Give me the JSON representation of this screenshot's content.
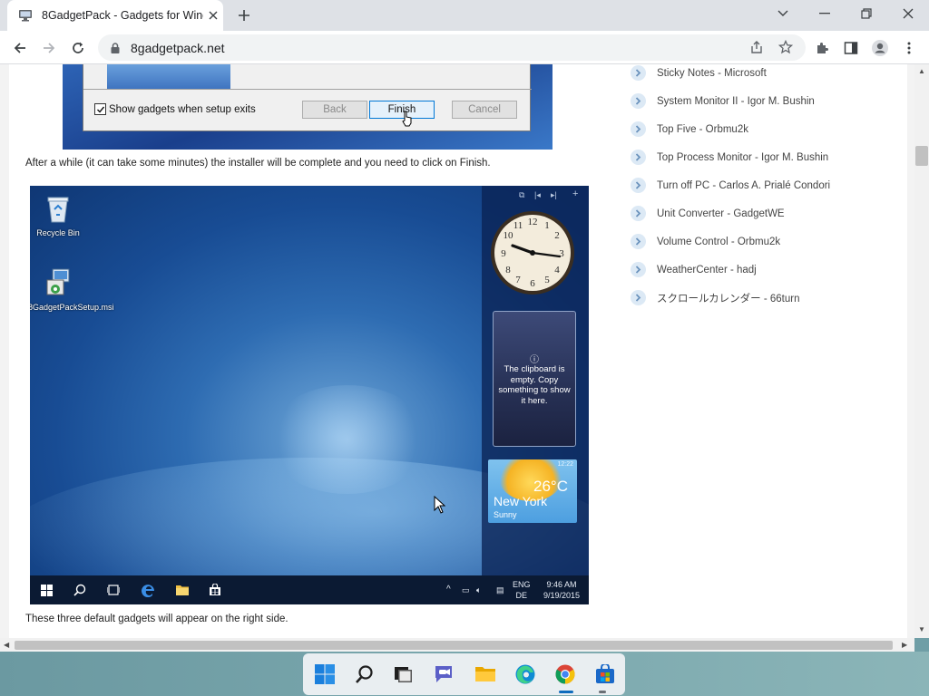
{
  "browser": {
    "tab_title": "8GadgetPack - Gadgets for Windows",
    "url": "8gadgetpack.net"
  },
  "installer": {
    "checkbox_label": "Show gadgets when setup exits",
    "checkbox_checked": true,
    "back_label": "Back",
    "finish_label": "Finish",
    "cancel_label": "Cancel"
  },
  "content": {
    "para_finish": "After a while (it can take some minutes) the installer will be complete and you need to click on Finish.",
    "para_gadgets": "These three default gadgets will appear on the right side."
  },
  "desktop": {
    "icons": [
      {
        "label": "Recycle Bin"
      },
      {
        "label": "8GadgetPackSetup.msi"
      }
    ],
    "clipboard_text": "The clipboard is empty. Copy something to show it here.",
    "weather": {
      "temperature": "26°C",
      "city": "New York",
      "condition": "Sunny",
      "time": "12:22"
    },
    "taskbar": {
      "lang_top": "ENG",
      "lang_bottom": "DE",
      "time": "9:46 AM",
      "date": "9/19/2015"
    }
  },
  "gadget_list": [
    {
      "label": "Sticky Notes - Microsoft"
    },
    {
      "label": "System Monitor II - Igor M. Bushin"
    },
    {
      "label": "Top Five - Orbmu2k"
    },
    {
      "label": "Top Process Monitor - Igor M. Bushin"
    },
    {
      "label": "Turn off PC - Carlos A. Prialé Condori"
    },
    {
      "label": "Unit Converter - GadgetWE"
    },
    {
      "label": "Volume Control - Orbmu2k"
    },
    {
      "label": "WeatherCenter - hadj"
    },
    {
      "label": "スクロールカレンダー - 66turn"
    }
  ],
  "colors": {
    "accent": "#1a73e8",
    "bullet": "#dce9f5",
    "bullet_arrow": "#6b93bd"
  }
}
